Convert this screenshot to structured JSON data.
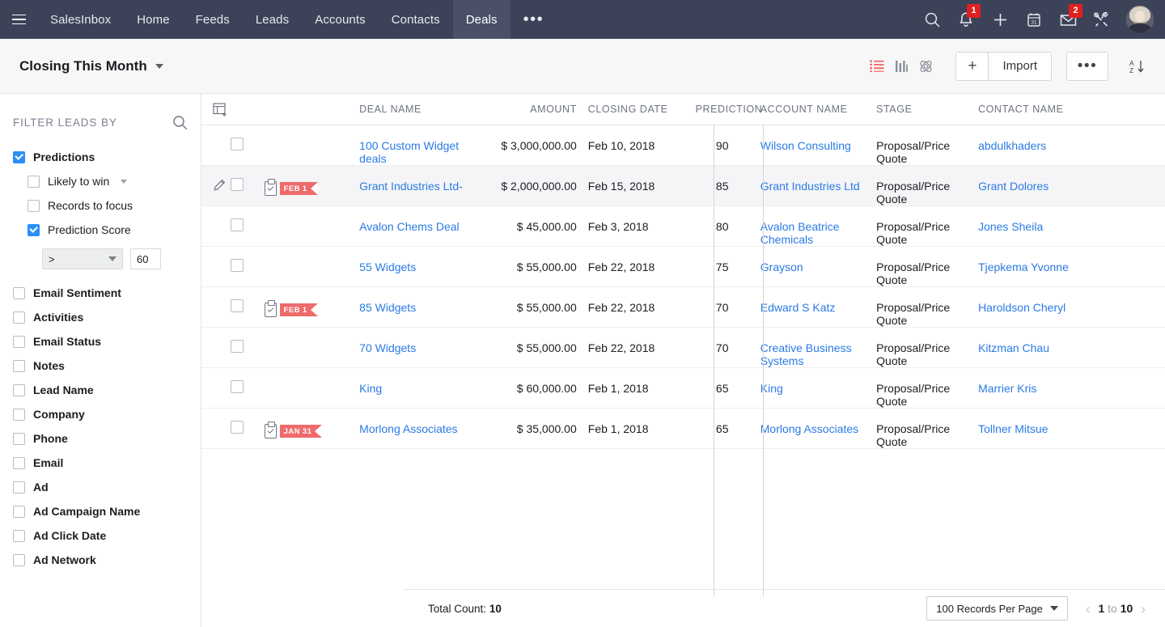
{
  "topnav": {
    "menu_icon": "hamburger-icon",
    "items": [
      {
        "label": "SalesInbox",
        "active": false
      },
      {
        "label": "Home",
        "active": false
      },
      {
        "label": "Feeds",
        "active": false
      },
      {
        "label": "Leads",
        "active": false
      },
      {
        "label": "Accounts",
        "active": false
      },
      {
        "label": "Contacts",
        "active": false
      },
      {
        "label": "Deals",
        "active": true
      }
    ],
    "more_label": "•••",
    "icons": [
      {
        "name": "search-icon",
        "badge": null
      },
      {
        "name": "notification-bell-icon",
        "badge": "1"
      },
      {
        "name": "add-plus-icon",
        "badge": null
      },
      {
        "name": "calendar-icon",
        "badge": null,
        "day": "31"
      },
      {
        "name": "mail-envelope-icon",
        "badge": "2"
      },
      {
        "name": "tools-setup-icon",
        "badge": null
      }
    ],
    "avatar_name": "user-avatar"
  },
  "toolbar": {
    "view_title": "Closing This Month",
    "view_icons": [
      {
        "name": "list-view-icon",
        "active": true
      },
      {
        "name": "kanban-view-icon",
        "active": false
      },
      {
        "name": "canvas-view-icon",
        "active": false
      }
    ],
    "plus_label": "+",
    "import_label": "Import",
    "more_label": "•••",
    "sort_icon": "sort-az-icon",
    "accent_color": "#ef6a6a"
  },
  "sidebar": {
    "title": "FILTER LEADS BY",
    "search_icon": "search-icon",
    "groups": [
      {
        "label": "Predictions",
        "checked": true,
        "bold": true,
        "children": [
          {
            "label": "Likely to win",
            "checked": false,
            "has_caret": true
          },
          {
            "label": "Records to focus",
            "checked": false,
            "has_caret": false
          },
          {
            "label": "Prediction Score",
            "checked": true,
            "has_caret": false
          }
        ]
      }
    ],
    "score_filter": {
      "operator": ">",
      "value": "60"
    },
    "items": [
      {
        "label": "Email Sentiment",
        "checked": false
      },
      {
        "label": "Activities",
        "checked": false
      },
      {
        "label": "Email Status",
        "checked": false
      },
      {
        "label": "Notes",
        "checked": false
      },
      {
        "label": "Lead Name",
        "checked": false
      },
      {
        "label": "Company",
        "checked": false
      },
      {
        "label": "Phone",
        "checked": false
      },
      {
        "label": "Email",
        "checked": false
      },
      {
        "label": "Ad",
        "checked": false
      },
      {
        "label": "Ad Campaign Name",
        "checked": false
      },
      {
        "label": "Ad Click Date",
        "checked": false
      },
      {
        "label": "Ad Network",
        "checked": false
      }
    ],
    "collapse_handle": "collapse-sidebar-handle"
  },
  "table": {
    "grip_icon": "add-column-icon",
    "columns": [
      "DEAL NAME",
      "AMOUNT",
      "CLOSING DATE",
      "PREDICTION",
      "ACCOUNT NAME",
      "STAGE",
      "CONTACT NAME"
    ],
    "rows": [
      {
        "selected": false,
        "hovered": false,
        "tag": null,
        "deal_name": "100 Custom Widget deals",
        "amount": "$ 3,000,000.00",
        "closing_date": "Feb 10, 2018",
        "prediction": "90",
        "account_name": "Wilson Consulting",
        "stage": "Proposal/Price Quote",
        "contact_name": "abdulkhaders"
      },
      {
        "selected": false,
        "hovered": true,
        "tag": "FEB 1",
        "deal_name": "Grant Industries Ltd-",
        "amount": "$ 2,000,000.00",
        "closing_date": "Feb 15, 2018",
        "prediction": "85",
        "account_name": "Grant Industries Ltd",
        "stage": "Proposal/Price Quote",
        "contact_name": "Grant Dolores"
      },
      {
        "selected": false,
        "hovered": false,
        "tag": null,
        "deal_name": "Avalon Chems Deal",
        "amount": "$ 45,000.00",
        "closing_date": "Feb 3, 2018",
        "prediction": "80",
        "account_name": "Avalon Beatrice Chemicals",
        "stage": "Proposal/Price Quote",
        "contact_name": "Jones Sheila"
      },
      {
        "selected": false,
        "hovered": false,
        "tag": null,
        "deal_name": "55 Widgets",
        "amount": "$ 55,000.00",
        "closing_date": "Feb 22, 2018",
        "prediction": "75",
        "account_name": "Grayson",
        "stage": "Proposal/Price Quote",
        "contact_name": "Tjepkema Yvonne"
      },
      {
        "selected": false,
        "hovered": false,
        "tag": "FEB 1",
        "deal_name": "85 Widgets",
        "amount": "$ 55,000.00",
        "closing_date": "Feb 22, 2018",
        "prediction": "70",
        "account_name": "Edward S Katz",
        "stage": "Proposal/Price Quote",
        "contact_name": "Haroldson Cheryl"
      },
      {
        "selected": false,
        "hovered": false,
        "tag": null,
        "deal_name": "70 Widgets",
        "amount": "$ 55,000.00",
        "closing_date": "Feb 22, 2018",
        "prediction": "70",
        "account_name": "Creative Business Systems",
        "stage": "Proposal/Price Quote",
        "contact_name": "Kitzman Chau"
      },
      {
        "selected": false,
        "hovered": false,
        "tag": null,
        "deal_name": "King",
        "amount": "$ 60,000.00",
        "closing_date": "Feb 1, 2018",
        "prediction": "65",
        "account_name": "King",
        "stage": "Proposal/Price Quote",
        "contact_name": "Marrier Kris"
      },
      {
        "selected": false,
        "hovered": false,
        "tag": "JAN 31",
        "deal_name": "Morlong Associates",
        "amount": "$ 35,000.00",
        "closing_date": "Feb 1, 2018",
        "prediction": "65",
        "account_name": "Morlong Associates",
        "stage": "Proposal/Price Quote",
        "contact_name": "Tollner Mitsue"
      }
    ]
  },
  "footer": {
    "total_label": "Total Count:",
    "total_value": "10",
    "records_per_page": "100 Records Per Page",
    "page_from": "1",
    "page_to_label": "to",
    "page_to": "10",
    "prev_icon": "chevron-left-icon",
    "next_icon": "chevron-right-icon"
  }
}
